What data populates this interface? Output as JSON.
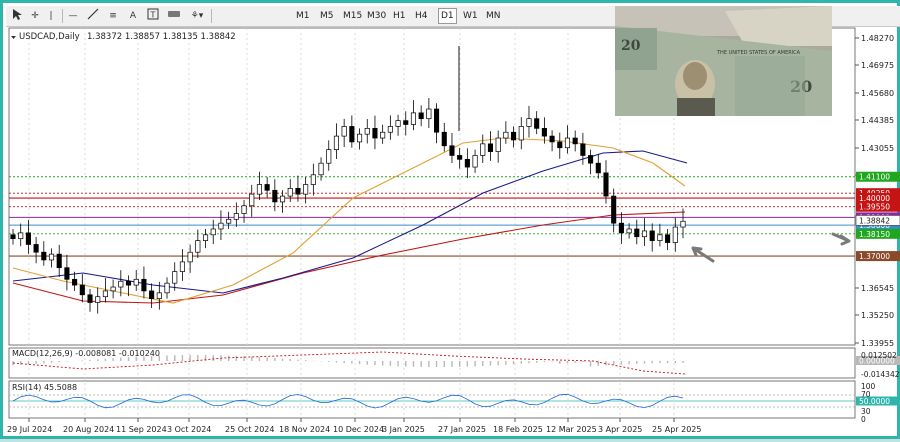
{
  "toolbar": {
    "tools": [
      "cursor-icon",
      "crosshair-icon",
      "vertical-line-icon",
      "horizontal-line-icon",
      "trendline-icon",
      "fibonacci-icon",
      "text-icon",
      "text-label-icon",
      "rectangle-icon",
      "shapes-icon"
    ],
    "timeframes": [
      "M1",
      "M5",
      "M15",
      "M30",
      "H1",
      "H4",
      "D1",
      "W1",
      "MN"
    ],
    "active_timeframe": "D1"
  },
  "header": {
    "symbol": "USDCAD,Daily",
    "ohlc": "1.38372 1.38857 1.38135 1.38842"
  },
  "price_axis": [
    "1.48270",
    "1.46975",
    "1.45680",
    "1.44385",
    "1.43055",
    "1.41760",
    "1.36545",
    "1.35250",
    "1.33955"
  ],
  "levels": [
    {
      "label": "1.41100",
      "color": "#1fa81f",
      "value": 1.411,
      "style": "dotted"
    },
    {
      "label": "1.40250",
      "color": "#c41414",
      "value": 1.4025,
      "style": "dotted"
    },
    {
      "label": "1.40000",
      "color": "#c41414",
      "value": 1.4,
      "style": "solid"
    },
    {
      "label": "1.39550",
      "color": "#c41414",
      "value": 1.3955,
      "style": "dotted"
    },
    {
      "label": "1.39000",
      "color": "#8e24aa",
      "value": 1.39,
      "style": "solid"
    },
    {
      "label": "1.38600",
      "color": "#3a8ec8",
      "value": 1.386,
      "style": "solid"
    },
    {
      "label": "1.38150",
      "color": "#1fa81f",
      "value": 1.3815,
      "style": "dotted"
    },
    {
      "label": "1.37000",
      "color": "#8a4a2a",
      "value": 1.37,
      "style": "solid"
    }
  ],
  "current_price": {
    "label": "1.38842",
    "value": 1.38842
  },
  "macd": {
    "label": "MACD(12,26,9) -0.008081 -0.010240",
    "axis": [
      "0.012502",
      "0.000000",
      "-0.014342"
    ]
  },
  "rsi": {
    "label": "RSI(14) 45.5088",
    "axis": [
      "100",
      "70",
      "50.0000",
      "30",
      "0"
    ]
  },
  "time_axis": [
    "29 Jul 2024",
    "20 Aug 2024",
    "11 Sep 2024",
    "3 Oct 2024",
    "25 Oct 2024",
    "18 Nov 2024",
    "10 Dec 2024",
    "3 Jan 2025",
    "27 Jan 2025",
    "18 Feb 2025",
    "12 Mar 2025",
    "3 Apr 2025",
    "25 Apr 2025"
  ],
  "colors": {
    "ma_fast": "#e2a033",
    "ma_mid": "#1a1a8c",
    "ma_slow": "#c41414",
    "grid": "#d2d2d2",
    "frame": "#2fb6ac"
  },
  "chart_data": {
    "type": "candlestick",
    "close": [
      1.379,
      1.382,
      1.376,
      1.372,
      1.368,
      1.371,
      1.364,
      1.358,
      1.355,
      1.35,
      1.346,
      1.349,
      1.352,
      1.354,
      1.357,
      1.355,
      1.358,
      1.352,
      1.348,
      1.351,
      1.356,
      1.362,
      1.367,
      1.372,
      1.378,
      1.381,
      1.384,
      1.387,
      1.389,
      1.392,
      1.396,
      1.402,
      1.407,
      1.404,
      1.398,
      1.401,
      1.405,
      1.402,
      1.407,
      1.412,
      1.418,
      1.425,
      1.432,
      1.437,
      1.429,
      1.433,
      1.436,
      1.431,
      1.434,
      1.437,
      1.44,
      1.438,
      1.444,
      1.441,
      1.446,
      1.434,
      1.427,
      1.422,
      1.42,
      1.416,
      1.422,
      1.428,
      1.424,
      1.431,
      1.434,
      1.43,
      1.437,
      1.441,
      1.436,
      1.432,
      1.429,
      1.426,
      1.431,
      1.428,
      1.422,
      1.418,
      1.413,
      1.401,
      1.387,
      1.382,
      1.384,
      1.38,
      1.383,
      1.378,
      1.381,
      1.377,
      1.385,
      1.388
    ],
    "ma_fast_end": 1.412,
    "ma_mid_end": 1.426,
    "ma_slow_end": 1.4025
  }
}
